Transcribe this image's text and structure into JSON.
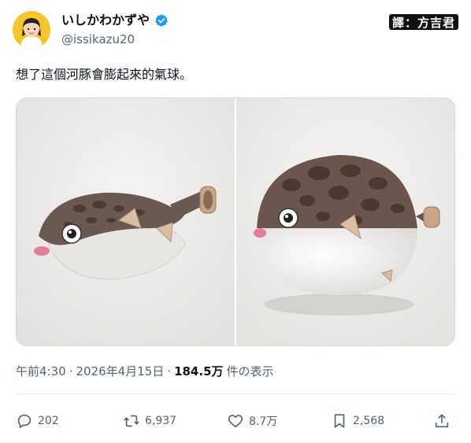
{
  "author": {
    "display_name": "いしかわかずや",
    "handle": "@issikazu20",
    "verified": true
  },
  "watermark": "譯：方吉君",
  "tweet": {
    "text": "想了這個河豚會膨起來的氣球。"
  },
  "meta": {
    "time": "午前4:30",
    "separator": "·",
    "date": "2026年4月15日",
    "views_count": "184.5万",
    "views_label": "件の表示"
  },
  "actions": {
    "replies": "202",
    "retweets": "6,937",
    "likes": "8.7万",
    "bookmarks": "2,568"
  },
  "colors": {
    "verified_blue": "#1d9bf0",
    "muted_text": "#536471",
    "avatar_bg": "#f6c62f"
  },
  "icons": [
    "verified-badge-icon",
    "reply-icon",
    "retweet-icon",
    "like-icon",
    "bookmark-icon",
    "share-icon"
  ]
}
